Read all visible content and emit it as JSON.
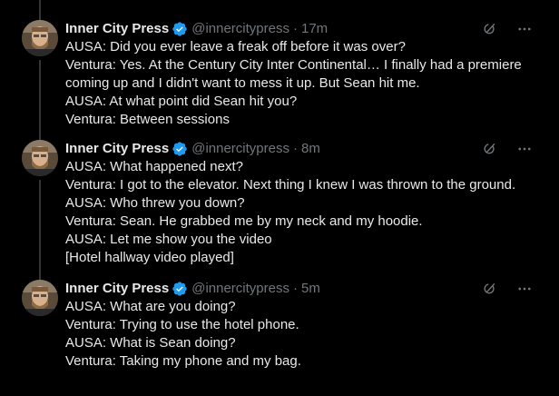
{
  "colors": {
    "background": "#000000",
    "text_primary": "#e7e9ea",
    "text_secondary": "#71767b",
    "verified_badge": "#1d9bf0",
    "thread_line": "#333639"
  },
  "tweets": [
    {
      "author_name": "Inner City Press",
      "handle": "@innercitypress",
      "separator": "·",
      "time": "17m",
      "verified_icon": "verified-badge-icon",
      "grok_icon": "grok-icon",
      "more_icon": "more-icon",
      "lines": [
        "AUSA: Did you ever leave a freak off before it was over?",
        "Ventura: Yes. At the Century City Inter Continental… I finally had a premiere",
        "coming up and I didn't want to mess it up. But Sean hit me.",
        "AUSA: At what point did Sean hit you?",
        "Ventura: Between sessions"
      ]
    },
    {
      "author_name": "Inner City Press",
      "handle": "@innercitypress",
      "separator": "·",
      "time": "8m",
      "verified_icon": "verified-badge-icon",
      "grok_icon": "grok-icon",
      "more_icon": "more-icon",
      "lines": [
        "AUSA: What happened next?",
        "Ventura: I got to the elevator. Next thing I knew I was thrown to the ground.",
        "AUSA: Who threw you down?",
        "Ventura: Sean. He grabbed me by my neck and my hoodie.",
        "AUSA: Let me show you the video",
        "[Hotel hallway video played]"
      ]
    },
    {
      "author_name": "Inner City Press",
      "handle": "@innercitypress",
      "separator": "·",
      "time": "5m",
      "verified_icon": "verified-badge-icon",
      "grok_icon": "grok-icon",
      "more_icon": "more-icon",
      "lines": [
        "AUSA: What are you doing?",
        "Ventura: Trying to use the hotel phone.",
        "AUSA: What is Sean doing?",
        "Ventura: Taking my phone and my bag."
      ]
    }
  ]
}
